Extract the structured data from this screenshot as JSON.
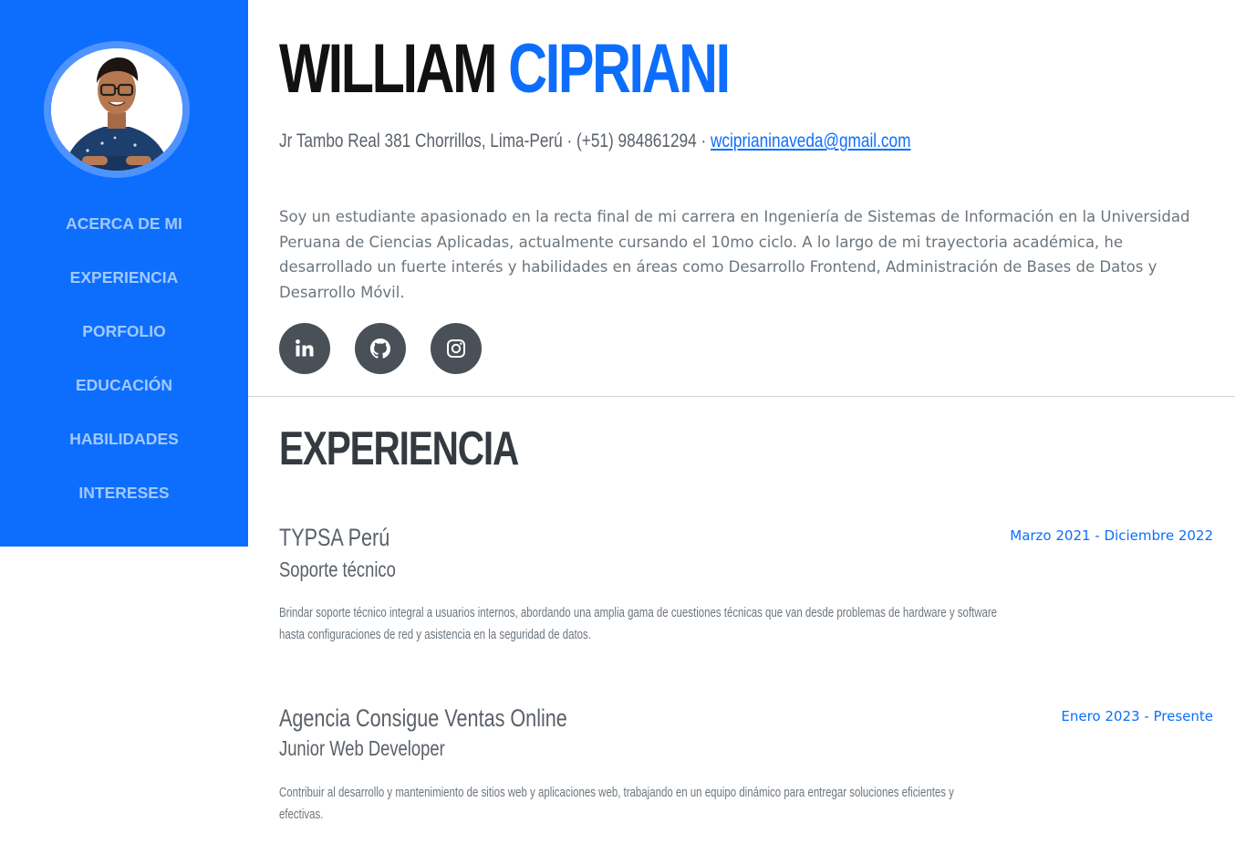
{
  "profile": {
    "first_name": "WILLIAM",
    "last_name": "CIPRIANI",
    "contact_prefix": "Jr Tambo Real 381 Chorrillos, Lima-Perú · (+51) 984861294 · ",
    "email": "wciprianinaveda@gmail.com",
    "about": "Soy un estudiante apasionado en la recta final de mi carrera en Ingeniería de Sistemas de Información en la Universidad Peruana de Ciencias Aplicadas, actualmente cursando el 10mo ciclo. A lo largo de mi trayectoria académica, he desarrollado un fuerte interés y habilidades en áreas como Desarrollo Frontend, Administración de Bases de Datos y Desarrollo Móvil."
  },
  "nav": {
    "items": [
      {
        "label": "ACERCA DE MI"
      },
      {
        "label": "EXPERIENCIA"
      },
      {
        "label": "PORFOLIO"
      },
      {
        "label": "EDUCACIÓN"
      },
      {
        "label": "HABILIDADES"
      },
      {
        "label": "INTERESES"
      }
    ]
  },
  "social": {
    "icons": [
      "linkedin-icon",
      "github-icon",
      "instagram-icon"
    ]
  },
  "experience": {
    "title": "EXPERIENCIA",
    "jobs": [
      {
        "company": "TYPSA Perú",
        "role": "Soporte técnico",
        "date": "Marzo 2021 - Diciembre 2022",
        "description": "Brindar soporte técnico integral a usuarios internos, abordando una amplia gama de cuestiones técnicas que van desde problemas de hardware y software hasta configuraciones de red y asistencia en la seguridad de datos."
      },
      {
        "company": "Agencia Consigue Ventas Online",
        "role": "Junior Web Developer",
        "date": "Enero 2023 - Presente",
        "description": "Contribuir al desarrollo y mantenimiento de sitios web y aplicaciones web, trabajando en un equipo dinámico para entregar soluciones eficientes y efectivas."
      }
    ]
  },
  "colors": {
    "primary": "#0d6efd",
    "sidebar": "#0d6efd",
    "text_muted": "#6c757d",
    "social_bg": "#495057"
  }
}
